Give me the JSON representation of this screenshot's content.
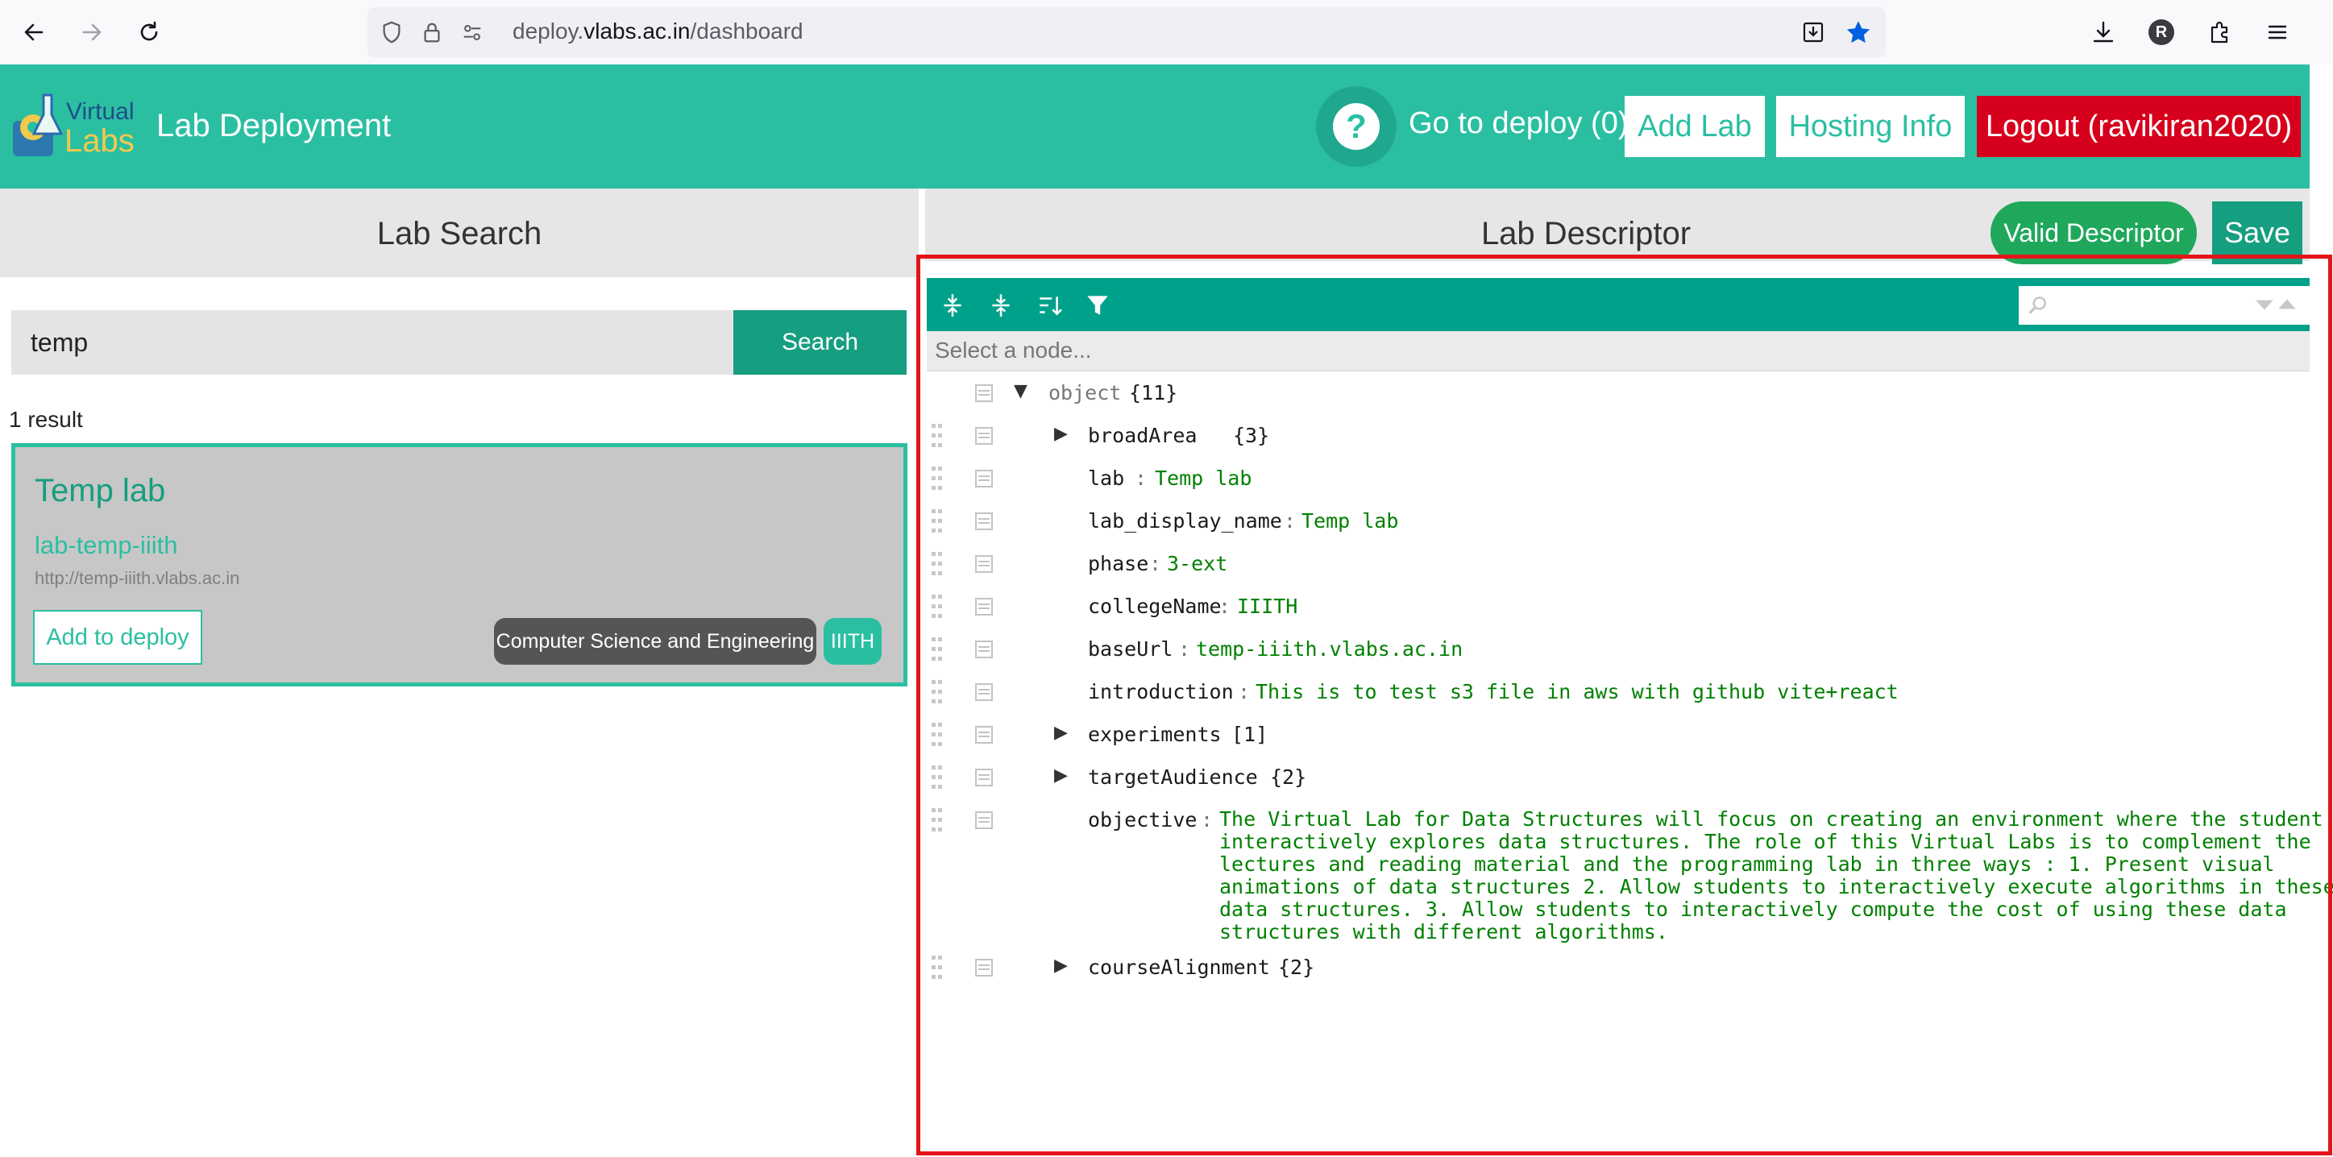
{
  "browser": {
    "url_prefix": "deploy.",
    "url_domain": "vlabs.ac.in",
    "url_path": "/dashboard",
    "avatar_letter": "R"
  },
  "header": {
    "logo_line1": "Virtual",
    "logo_line2": "Labs",
    "title": "Lab Deployment",
    "help_symbol": "?",
    "go_deploy": "Go to deploy (0)",
    "add_lab": "Add Lab",
    "hosting_info": "Hosting Info",
    "logout": "Logout (ravikiran2020)"
  },
  "left_panel": {
    "title": "Lab Search",
    "search_value": "temp",
    "search_button": "Search",
    "result_count": "1 result",
    "result": {
      "name": "Temp lab",
      "id": "lab-temp-iiith",
      "url": "http://temp-iiith.vlabs.ac.in",
      "add_button": "Add to deploy",
      "discipline": "Computer Science and Engineering",
      "institute": "IIITH"
    }
  },
  "right_panel": {
    "title": "Lab Descriptor",
    "valid_button": "Valid Descriptor",
    "save_button": "Save",
    "navbar_placeholder": "Select a node..."
  },
  "tree": {
    "root_label": "object",
    "root_count": "{11}",
    "nodes": [
      {
        "key": "broadArea",
        "count": "{3}"
      },
      {
        "key": "lab",
        "value": "Temp lab"
      },
      {
        "key": "lab_display_name",
        "value": "Temp lab"
      },
      {
        "key": "phase",
        "value": "3-ext"
      },
      {
        "key": "collegeName",
        "value": "IIITH"
      },
      {
        "key": "baseUrl",
        "value": "temp-iiith.vlabs.ac.in"
      },
      {
        "key": "introduction",
        "value": "This is to test s3 file in aws with github vite+react"
      },
      {
        "key": "experiments",
        "count": "[1]"
      },
      {
        "key": "targetAudience",
        "count": "{2}"
      },
      {
        "key": "objective",
        "value": "The Virtual Lab for Data Structures will focus on creating an environment where the student interactively explores data structures. The role of this Virtual Labs is to complement the lectures and reading material and the programming lab in three ways : 1. Present visual animations of data structures 2. Allow students to interactively execute algorithms in these data structures. 3. Allow students to interactively compute the cost of using these data structures with different algorithms."
      },
      {
        "key": "courseAlignment",
        "count": "{2}"
      }
    ]
  },
  "colors": {
    "accent": "#2bbfa2",
    "accent_dark": "#159e80",
    "logout": "#d6001c",
    "valid": "#1fa85b",
    "highlight": "#e3151a"
  }
}
